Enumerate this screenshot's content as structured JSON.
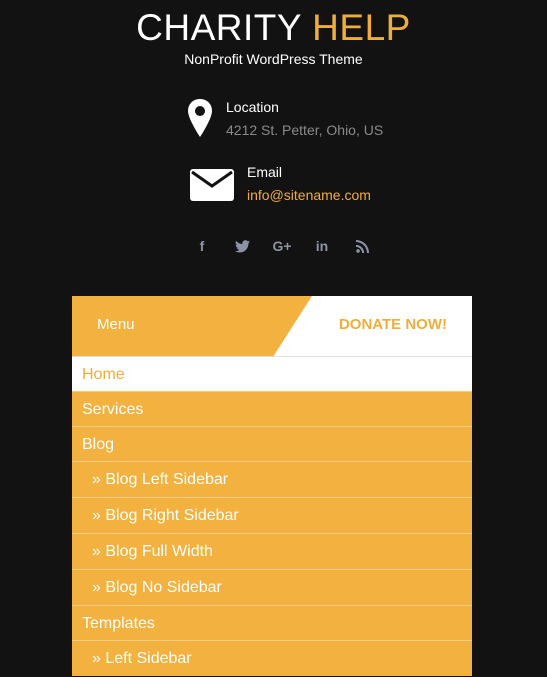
{
  "brand": {
    "title_white": "CHARITY",
    "title_orange": "HELP",
    "tagline": "NonProfit WordPress Theme"
  },
  "contact": {
    "location": {
      "label": "Location",
      "value": "4212 St. Petter, Ohio, US"
    },
    "email": {
      "label": "Email",
      "value": "info@sitename.com"
    }
  },
  "social": [
    "f",
    "t",
    "G+",
    "in",
    "rss"
  ],
  "nav": {
    "menu_label": "Menu",
    "donate_label": "DONATE NOW!"
  },
  "menu": {
    "items": [
      {
        "label": "Home"
      },
      {
        "label": "Services"
      },
      {
        "label": "Blog"
      },
      {
        "label": "» Blog Left Sidebar"
      },
      {
        "label": "» Blog Right Sidebar"
      },
      {
        "label": "» Blog Full Width"
      },
      {
        "label": "» Blog No Sidebar"
      },
      {
        "label": "Templates"
      },
      {
        "label": "» Left Sidebar"
      }
    ]
  },
  "colors": {
    "accent": "#f3b13f",
    "background": "#121212",
    "muted": "#8a8a8a"
  }
}
